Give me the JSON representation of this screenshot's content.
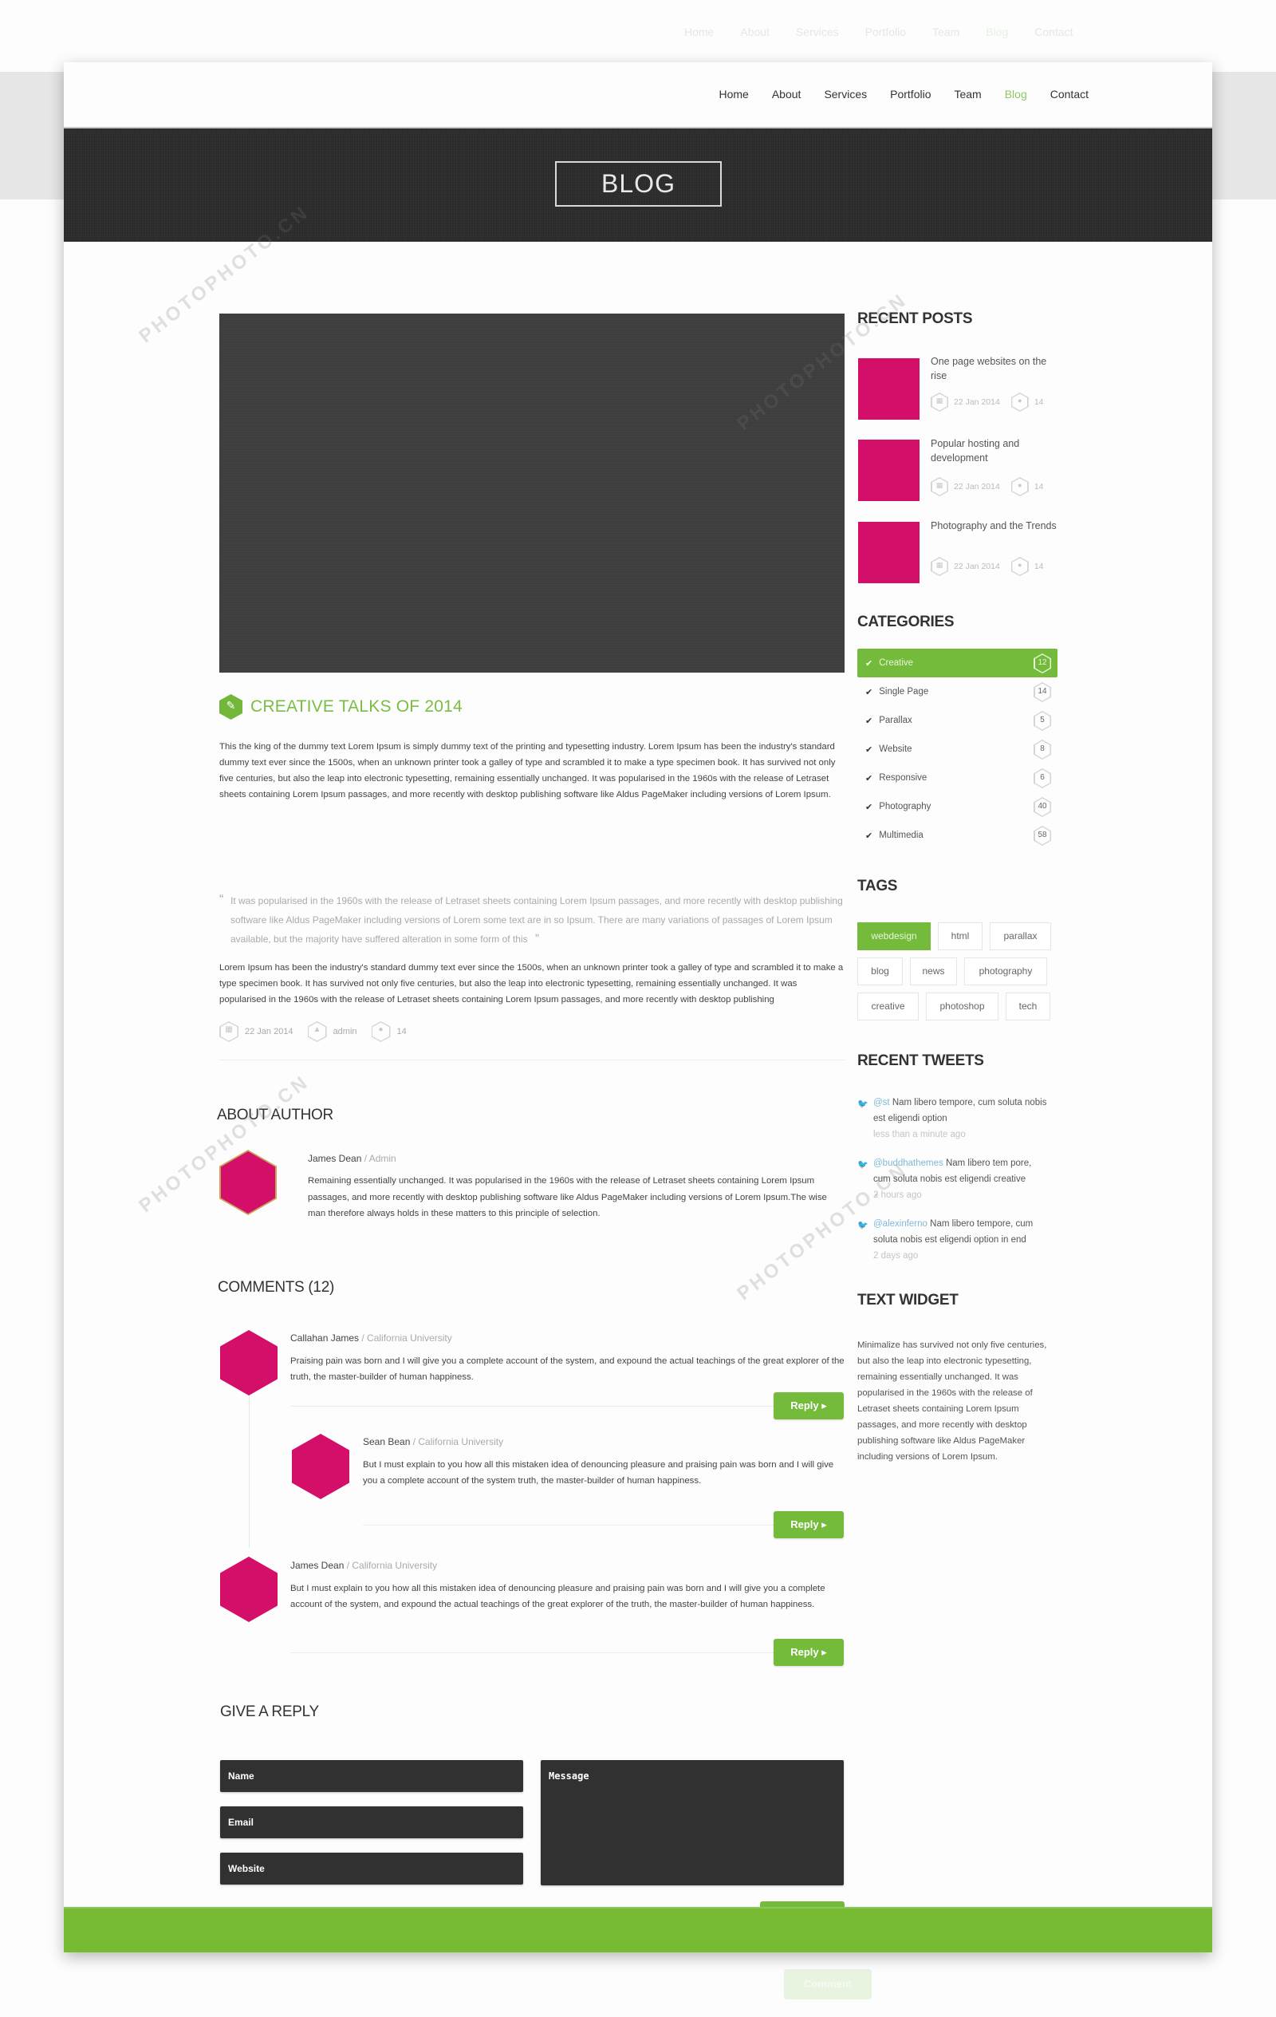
{
  "nav": {
    "items": [
      {
        "label": "Home",
        "active": false
      },
      {
        "label": "About",
        "active": false
      },
      {
        "label": "Services",
        "active": false
      },
      {
        "label": "Portfolio",
        "active": false
      },
      {
        "label": "Team",
        "active": false
      },
      {
        "label": "Blog",
        "active": true
      },
      {
        "label": "Contact",
        "active": false
      }
    ]
  },
  "banner": {
    "title": "BLOG"
  },
  "post": {
    "title": "CREATIVE TALKS OF 2014",
    "paragraph1": "This the king of the dummy text Lorem Ipsum is simply dummy text of the printing and typesetting industry. Lorem Ipsum has been the industry's standard dummy text ever since the 1500s, when an unknown printer took a galley of type and scrambled it to make a type specimen book. It has survived not only five centuries, but also the leap into electronic typesetting, remaining essentially unchanged. It was popularised in the 1960s with the release of Letraset sheets containing Lorem Ipsum passages, and more recently with desktop publishing software like Aldus PageMaker including versions of Lorem Ipsum.",
    "quote": "It was popularised in the 1960s with the release of Letraset sheets containing Lorem Ipsum passages, and more recently with desktop publishing software like Aldus PageMaker including versions of Lorem some text are in so Ipsum. There are many variations of passages of Lorem Ipsum available, but the majority have suffered alteration in some form of this",
    "quote_open": "“",
    "quote_close": "”",
    "paragraph2": "Lorem Ipsum has been the industry's standard dummy text ever since the 1500s, when an unknown printer took a galley of type and scrambled it to make a type specimen book. It has survived not only five centuries, but also the leap into electronic typesetting, remaining essentially unchanged. It was popularised in the 1960s with the release of Letraset sheets containing Lorem Ipsum passages, and more recently with desktop publishing",
    "meta": {
      "date": "22 Jan 2014",
      "author": "admin",
      "comments": "14"
    }
  },
  "about_author": {
    "heading": "ABOUT AUTHOR",
    "name": "James Dean",
    "role": " / Admin",
    "bio": "Remaining essentially unchanged. It was popularised in the 1960s with the release of Letraset sheets containing Lorem Ipsum passages, and more recently with desktop publishing software like Aldus PageMaker including versions of Lorem Ipsum.The wise man therefore always holds in these matters to this principle of selection."
  },
  "comments": {
    "heading": "COMMENTS (12)",
    "reply_label": "Reply ▸",
    "items": [
      {
        "name": "Callahan James",
        "affiliation": " / California University",
        "text": "Praising pain was born and I will give you a complete account of the system, and expound the actual teachings of the great explorer of the truth, the master-builder of human happiness."
      },
      {
        "name": "Sean Bean",
        "affiliation": " / California University",
        "text": "But I must explain to you how all this mistaken idea of denouncing pleasure and praising pain was born and I will give you a complete account of the system truth, the master-builder of human happiness."
      },
      {
        "name": "James Dean",
        "affiliation": " / California University",
        "text": "But I must explain to you how all this mistaken idea of denouncing pleasure and praising pain was born and I will give you a complete account of the system, and expound the actual teachings of the great explorer of the truth, the master-builder of human happiness."
      }
    ]
  },
  "reply_form": {
    "heading": "GIVE A REPLY",
    "name_placeholder": "Name",
    "email_placeholder": "Email",
    "website_placeholder": "Website",
    "message_placeholder": "Message",
    "submit_label": "Comment"
  },
  "sidebar": {
    "recent_posts": {
      "heading": "RECENT POSTS",
      "items": [
        {
          "title": "One page websites on the rise",
          "date": "22 Jan 2014",
          "comments": "14"
        },
        {
          "title": "Popular hosting and development",
          "date": "22 Jan 2014",
          "comments": "14"
        },
        {
          "title": "Photography and the Trends",
          "date": "22 Jan 2014",
          "comments": "14"
        }
      ]
    },
    "categories": {
      "heading": "CATEGORIES",
      "items": [
        {
          "label": "Creative",
          "count": "12",
          "active": true
        },
        {
          "label": "Single Page",
          "count": "14",
          "active": false
        },
        {
          "label": "Parallax",
          "count": "5",
          "active": false
        },
        {
          "label": "Website",
          "count": "8",
          "active": false
        },
        {
          "label": "Responsive",
          "count": "6",
          "active": false
        },
        {
          "label": "Photography",
          "count": "40",
          "active": false
        },
        {
          "label": "Multimedia",
          "count": "58",
          "active": false
        }
      ]
    },
    "tags": {
      "heading": "TAGS",
      "rows": [
        [
          {
            "label": "webdesign",
            "active": true
          },
          {
            "label": "html",
            "active": false
          },
          {
            "label": "parallax",
            "active": false
          }
        ],
        [
          {
            "label": "blog",
            "active": false
          },
          {
            "label": "news",
            "active": false
          },
          {
            "label": "photography",
            "active": false
          }
        ],
        [
          {
            "label": "creative",
            "active": false
          },
          {
            "label": "photoshop",
            "active": false
          },
          {
            "label": "tech",
            "active": false
          }
        ]
      ]
    },
    "recent_tweets": {
      "heading": "RECENT TWEETS",
      "items": [
        {
          "handle": "@st",
          "text": " Nam libero tempore, cum soluta nobis est eligendi option",
          "time": "less than a minute ago"
        },
        {
          "handle": "@buddhathemes",
          "text": " Nam libero tem pore, cum soluta nobis est eligendi creative",
          "time": "2 hours ago"
        },
        {
          "handle": "@alexinferno",
          "text": " Nam libero tempore, cum soluta nobis est eligendi option in end",
          "time": "2 days ago"
        }
      ]
    },
    "text_widget": {
      "heading": "TEXT WIDGET",
      "body": "Minimalize has survived not only five centuries, but also the leap into electronic typesetting, remaining essentially unchanged. It was popularised in the 1960s with the release of Letraset sheets containing Lorem Ipsum passages, and more recently with desktop publishing software like Aldus PageMaker including versions of Lorem Ipsum."
    }
  },
  "watermark": {
    "text": "PHOTOPHOTO.CN"
  },
  "colors": {
    "accent_green": "#74bb3b",
    "title_green": "#79bd45",
    "thumb_magenta": "#d40f69",
    "dark": "#2b2b2b",
    "tweet_link": "#7fb9d8"
  }
}
